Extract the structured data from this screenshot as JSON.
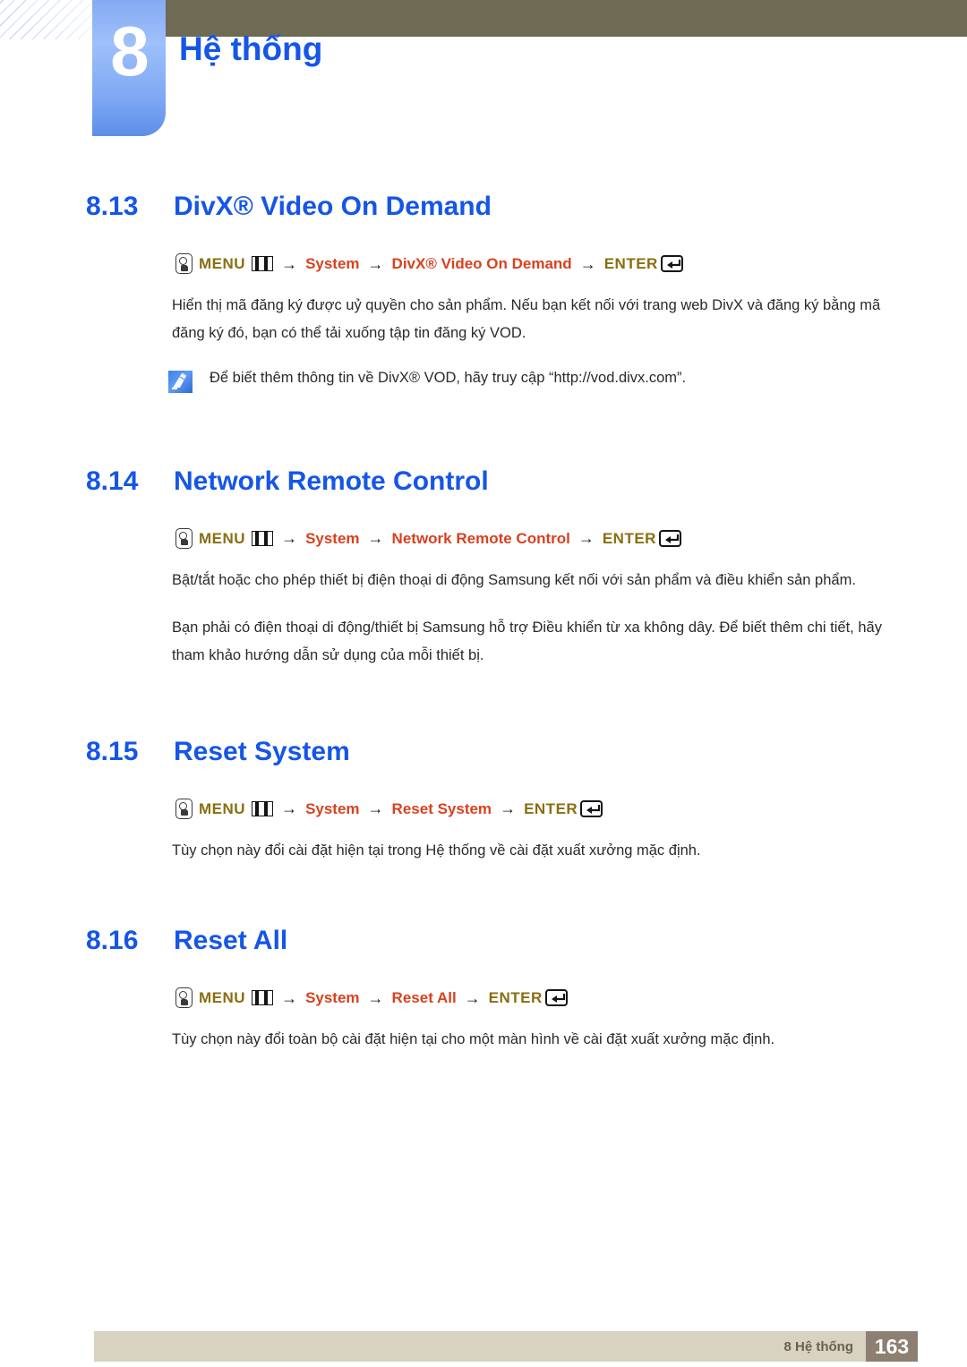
{
  "header": {
    "chapter_number": "8",
    "chapter_title": "Hệ thống"
  },
  "sections": [
    {
      "number": "8.13",
      "title": "DivX® Video On Demand",
      "menu_path": {
        "press_icon": "press-button-icon",
        "menu_label": "MENU",
        "menu_icon": "menu-bars-icon",
        "arrow": "→",
        "items": [
          "System",
          "DivX® Video On Demand"
        ],
        "enter_label": "ENTER",
        "enter_icon": "enter-return-icon"
      },
      "body": "Hiển thị mã đăng ký được uỷ quyền cho sản phẩm. Nếu bạn kết nối với trang web DivX và đăng ký bằng mã đăng ký đó, bạn có thể tải xuống tập tin đăng ký VOD.",
      "note": {
        "icon": "note-pen-icon",
        "text": "Để biết thêm thông tin về DivX® VOD, hãy truy cập “http://vod.divx.com”."
      }
    },
    {
      "number": "8.14",
      "title": "Network Remote Control",
      "menu_path": {
        "menu_label": "MENU",
        "items": [
          "System",
          "Network Remote Control"
        ],
        "enter_label": "ENTER"
      },
      "body": "Bật/tắt hoặc cho phép thiết bị điện thoại di động Samsung kết nối với sản phẩm và điều khiển sản phẩm.",
      "body2": "Bạn phải có điện thoại di động/thiết bị Samsung hỗ trợ Điều khiển từ xa không dây. Để biết thêm chi tiết, hãy tham khảo hướng dẫn sử dụng của mỗi thiết bị."
    },
    {
      "number": "8.15",
      "title": "Reset System",
      "menu_path": {
        "menu_label": "MENU",
        "items": [
          "System",
          "Reset System"
        ],
        "enter_label": "ENTER"
      },
      "body": "Tùy chọn này đổi cài đặt hiện tại trong Hệ thống về cài đặt xuất xưởng mặc định."
    },
    {
      "number": "8.16",
      "title": "Reset All",
      "menu_path": {
        "menu_label": "MENU",
        "items": [
          "System",
          "Reset All"
        ],
        "enter_label": "ENTER"
      },
      "body": "Tùy chọn này đổi toàn bộ cài đặt hiện tại cho một màn hình về cài đặt xuất xưởng mặc định."
    }
  ],
  "footer": {
    "label": "8 Hệ thống",
    "page_number": "163"
  },
  "colors": {
    "heading_blue": "#1556e8",
    "menu_gold": "#8a6e10",
    "menu_orange": "#d9411e",
    "olive_bar": "#6e6a53",
    "footer_bar": "#d8d3c0",
    "footer_pagebox": "#8e7f73"
  }
}
